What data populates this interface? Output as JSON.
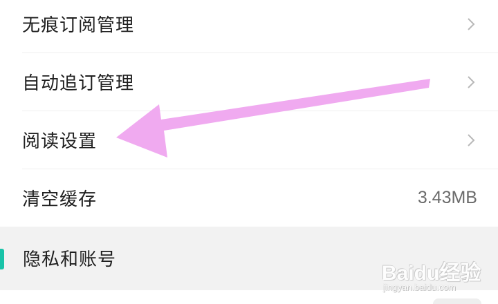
{
  "settings": {
    "items": [
      {
        "label": "无痕订阅管理"
      },
      {
        "label": "自动追订管理"
      },
      {
        "label": "阅读设置"
      },
      {
        "label": "清空缓存",
        "value": "3.43MB"
      }
    ]
  },
  "section": {
    "title": "隐私和账号",
    "accent_color": "#19c3a8"
  },
  "annotation": {
    "arrow_color": "#f0aaf0",
    "arrow_icon": "arrow-pointer-icon"
  },
  "watermark": {
    "brand": "Baidu经验",
    "url": "jingyan.baidu.com"
  }
}
